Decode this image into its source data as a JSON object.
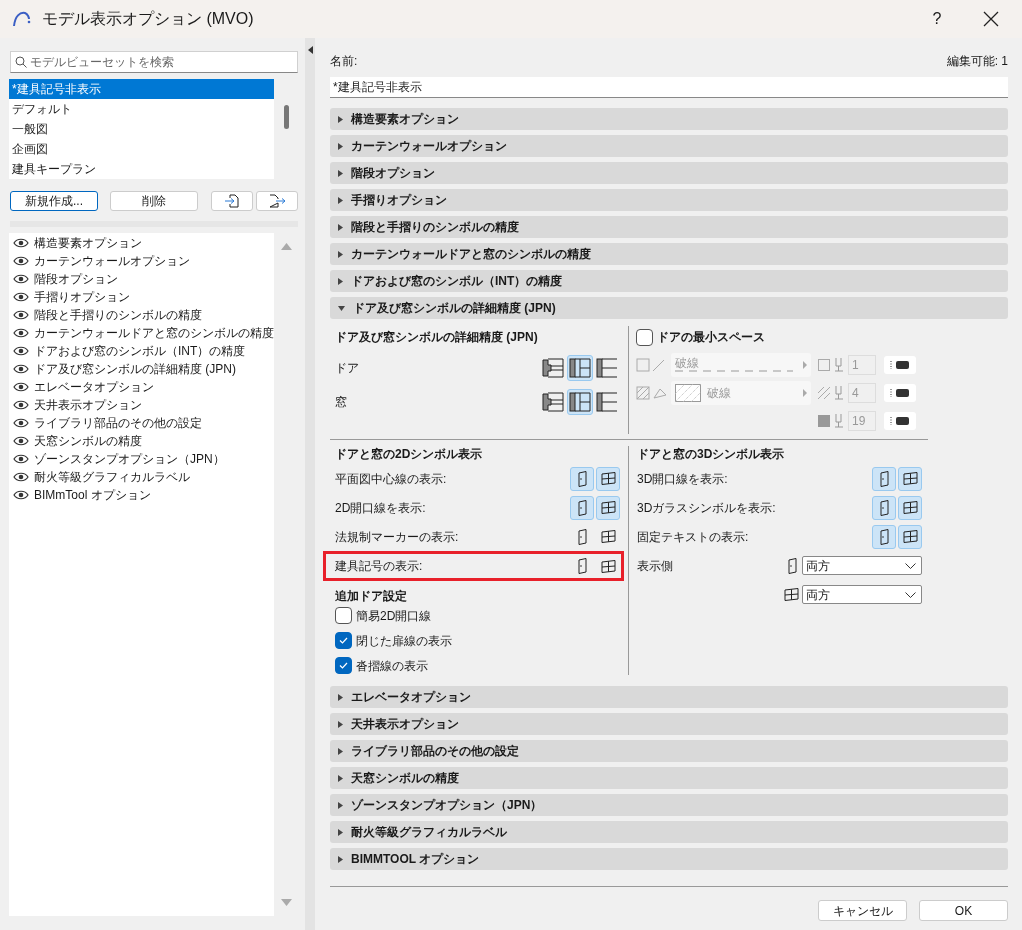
{
  "window": {
    "title": "モデル表示オプション (MVO)",
    "help": "?"
  },
  "search": {
    "placeholder": "モデルビューセットを検索"
  },
  "presets": [
    {
      "label": "*建具記号非表示",
      "selected": true
    },
    {
      "label": "デフォルト",
      "selected": false
    },
    {
      "label": "一般図",
      "selected": false
    },
    {
      "label": "企画図",
      "selected": false
    },
    {
      "label": "建具キープラン",
      "selected": false
    }
  ],
  "preset_buttons": [
    "新規作成...",
    "削除"
  ],
  "options_list": [
    {
      "label": "構造要素オプション"
    },
    {
      "label": "カーテンウォールオプション"
    },
    {
      "label": "階段オプション"
    },
    {
      "label": "手摺りオプション"
    },
    {
      "label": "階段と手摺りのシンボルの精度"
    },
    {
      "label": "カーテンウォールドアと窓のシンボルの精度"
    },
    {
      "label": "ドアおよび窓のシンボル（INT）の精度"
    },
    {
      "label": "ドア及び窓シンボルの詳細精度 (JPN)"
    },
    {
      "label": "エレベータオプション"
    },
    {
      "label": "天井表示オプション"
    },
    {
      "label": "ライブラリ部品のその他の設定"
    },
    {
      "label": "天窓シンボルの精度"
    },
    {
      "label": "ゾーンスタンプオプション（JPN）"
    },
    {
      "label": "耐火等級グラフィカルラベル"
    },
    {
      "label": "BIMmTool オプション"
    }
  ],
  "name_label": "名前:",
  "editable": "編集可能: 1",
  "name_value": "*建具記号非表示",
  "sections": [
    {
      "label": "構造要素オプション",
      "expanded": false
    },
    {
      "label": "カーテンウォールオプション",
      "expanded": false
    },
    {
      "label": "階段オプション",
      "expanded": false
    },
    {
      "label": "手摺りオプション",
      "expanded": false
    },
    {
      "label": "階段と手摺りのシンボルの精度",
      "expanded": false
    },
    {
      "label": "カーテンウォールドアと窓のシンボルの精度",
      "expanded": false
    },
    {
      "label": "ドアおよび窓のシンボル（INT）の精度",
      "expanded": false
    },
    {
      "label": "ドア及び窓シンボルの詳細精度 (JPN)",
      "expanded": true
    },
    {
      "label": "エレベータオプション",
      "expanded": false
    },
    {
      "label": "天井表示オプション",
      "expanded": false
    },
    {
      "label": "ライブラリ部品のその他の設定",
      "expanded": false
    },
    {
      "label": "天窓シンボルの精度",
      "expanded": false
    },
    {
      "label": "ゾーンスタンプオプション（JPN）",
      "expanded": false
    },
    {
      "label": "耐火等級グラフィカルラベル",
      "expanded": false
    },
    {
      "label": "BIMMTOOL オプション",
      "expanded": false
    }
  ],
  "detail": {
    "precision": {
      "title": "ドア及び窓シンボルの詳細精度 (JPN)",
      "rows": [
        {
          "label": "ドア",
          "options": [
            {
              "selected": false
            },
            {
              "selected": true
            },
            {
              "selected": false
            }
          ]
        },
        {
          "label": "窓",
          "options": [
            {
              "selected": false
            },
            {
              "selected": true
            },
            {
              "selected": false
            }
          ]
        }
      ]
    },
    "min_space": {
      "label": "ドアの最小スペース",
      "checked": false,
      "line_type": "破線",
      "fill_type": "破線",
      "pens": [
        "1",
        "4",
        "19"
      ]
    },
    "symbols_2d": {
      "title": "ドアと窓の2Dシンボル表示",
      "rows": [
        {
          "label": "平面図中心線の表示:",
          "door": true,
          "window": true,
          "highlighted": false
        },
        {
          "label": "2D開口線を表示:",
          "door": true,
          "window": true,
          "highlighted": false
        },
        {
          "label": "法規制マーカーの表示:",
          "door": false,
          "window": false,
          "highlighted": false
        },
        {
          "label": "建具記号の表示:",
          "door": false,
          "window": false,
          "highlighted": true
        }
      ]
    },
    "door_settings": {
      "title": "追加ドア設定",
      "checkboxes": [
        {
          "label": "簡易2D開口線",
          "checked": false
        },
        {
          "label": "閉じた扉線の表示",
          "checked": true
        },
        {
          "label": "沓摺線の表示",
          "checked": true
        }
      ]
    },
    "symbols_3d": {
      "title": "ドアと窓の3Dシンボル表示",
      "rows": [
        {
          "label": "3D開口線を表示:",
          "door": true,
          "window": true
        },
        {
          "label": "3Dガラスシンボルを表示:",
          "door": true,
          "window": true
        },
        {
          "label": "固定テキストの表示:",
          "door": true,
          "window": true
        }
      ],
      "display_side": {
        "label": "表示側",
        "door_value": "両方",
        "window_value": "両方"
      }
    }
  },
  "buttons": [
    "キャンセル",
    "OK"
  ]
}
